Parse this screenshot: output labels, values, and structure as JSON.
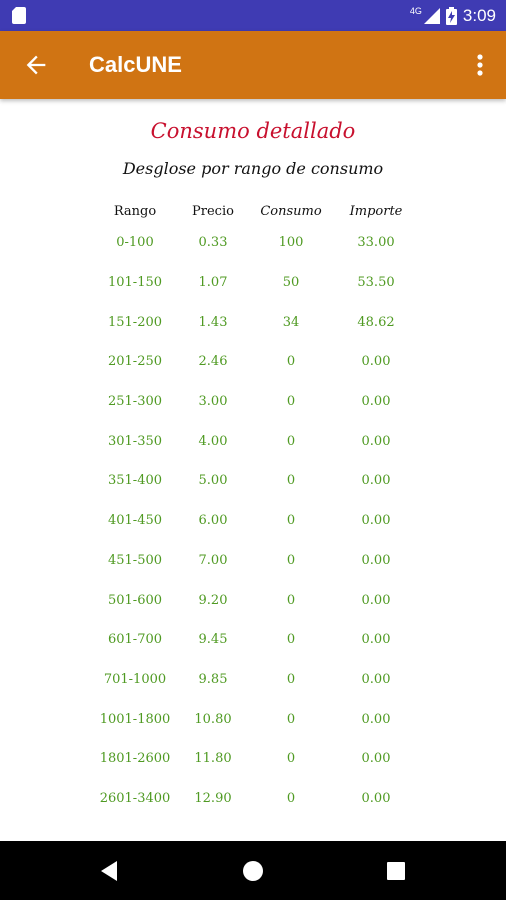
{
  "status_bar": {
    "network": "4G",
    "battery_icon": "battery-charging-icon",
    "time": "3:09"
  },
  "app_bar": {
    "title": "CalcUNE",
    "background": "#d07413"
  },
  "content": {
    "heading": "Consumo detallado",
    "subheading": "Desglose por rango de consumo",
    "table": {
      "headers": [
        "Rango",
        "Precio",
        "Consumo",
        "Importe"
      ],
      "rows": [
        [
          "0-100",
          "0.33",
          "100",
          "33.00"
        ],
        [
          "101-150",
          "1.07",
          "50",
          "53.50"
        ],
        [
          "151-200",
          "1.43",
          "34",
          "48.62"
        ],
        [
          "201-250",
          "2.46",
          "0",
          "0.00"
        ],
        [
          "251-300",
          "3.00",
          "0",
          "0.00"
        ],
        [
          "301-350",
          "4.00",
          "0",
          "0.00"
        ],
        [
          "351-400",
          "5.00",
          "0",
          "0.00"
        ],
        [
          "401-450",
          "6.00",
          "0",
          "0.00"
        ],
        [
          "451-500",
          "7.00",
          "0",
          "0.00"
        ],
        [
          "501-600",
          "9.20",
          "0",
          "0.00"
        ],
        [
          "601-700",
          "9.45",
          "0",
          "0.00"
        ],
        [
          "701-1000",
          "9.85",
          "0",
          "0.00"
        ],
        [
          "1001-1800",
          "10.80",
          "0",
          "0.00"
        ],
        [
          "1801-2600",
          "11.80",
          "0",
          "0.00"
        ],
        [
          "2601-3400",
          "12.90",
          "0",
          "0.00"
        ]
      ]
    },
    "colors": {
      "heading": "#c8102e",
      "values": "#4f9a22"
    }
  },
  "nav_bar": {
    "icons": [
      "back-triangle-icon",
      "home-circle-icon",
      "recents-square-icon"
    ]
  }
}
